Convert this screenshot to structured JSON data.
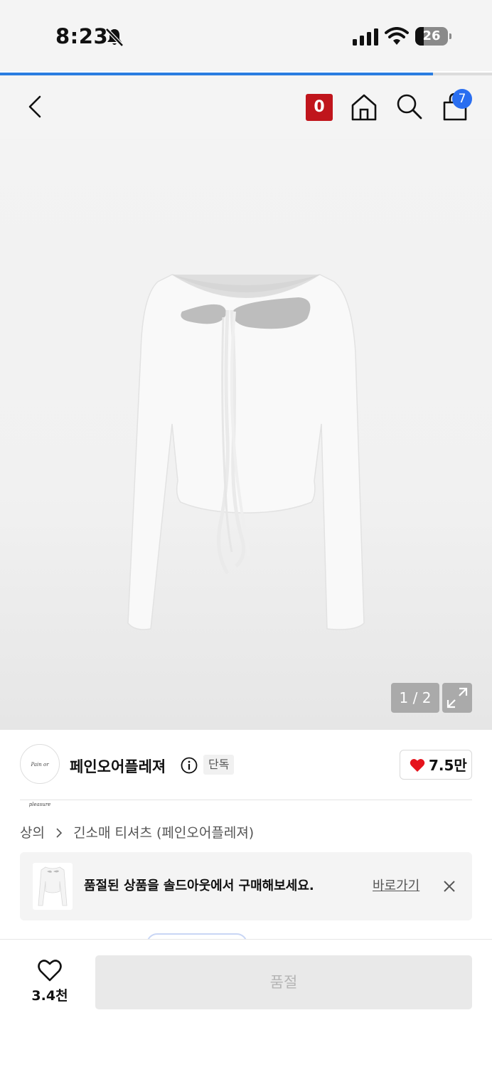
{
  "status_bar": {
    "time": "8:23",
    "battery": "26",
    "icons": [
      "bell-slash-icon",
      "signal-icon",
      "wifi-icon",
      "battery-icon"
    ]
  },
  "page_progress": 0.88,
  "nav": {
    "badge": "0",
    "bag_count": "7",
    "icons": [
      "back-icon",
      "home-icon",
      "search-icon",
      "shopping-bag-icon"
    ]
  },
  "gallery": {
    "counter": "1 / 2"
  },
  "brand": {
    "logo_text": "Pain or pleasure",
    "name": "페인오어플레져",
    "tag": "단독",
    "like_count": "7.5만"
  },
  "breadcrumb": {
    "items": [
      "상의",
      "긴소매 티셔츠 (페인오어플레져)"
    ]
  },
  "soldout_banner": {
    "message": "품절된 상품을 솔드아웃에서 구매해보세요.",
    "link": "바로가기"
  },
  "bottom_bar": {
    "wish_count": "3.4천",
    "buy_label": "품절"
  },
  "colors": {
    "accent_blue": "#2a7de1",
    "badge_red": "#c0151c",
    "heart_red": "#e5131c",
    "bag_badge_blue": "#2a6ef0"
  }
}
